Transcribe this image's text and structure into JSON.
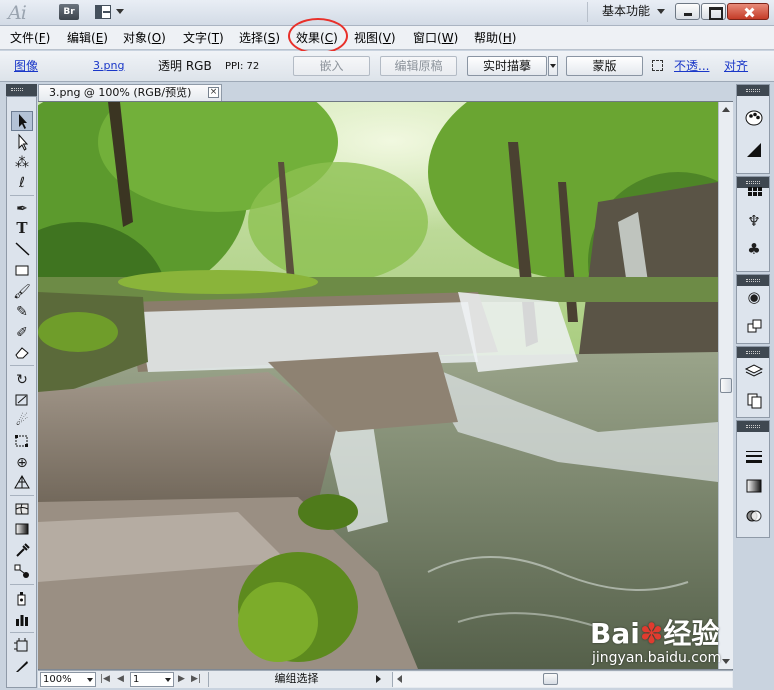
{
  "titlebar": {
    "logo": "Ai",
    "bridge_label": "Br",
    "workspace": "基本功能"
  },
  "menu": [
    {
      "label": "文件(",
      "acc": "F",
      "end": ")"
    },
    {
      "label": "编辑(",
      "acc": "E",
      "end": ")"
    },
    {
      "label": "对象(",
      "acc": "O",
      "end": ")"
    },
    {
      "label": "文字(",
      "acc": "T",
      "end": ")"
    },
    {
      "label": "选择(",
      "acc": "S",
      "end": ")"
    },
    {
      "label": "效果(",
      "acc": "C",
      "end": ")"
    },
    {
      "label": "视图(",
      "acc": "V",
      "end": ")"
    },
    {
      "label": "窗口(",
      "acc": "W",
      "end": ")"
    },
    {
      "label": "帮助(",
      "acc": "H",
      "end": ")"
    }
  ],
  "control": {
    "type_link": "图像",
    "file_link": "3.png",
    "mode": "透明 RGB",
    "ppi": "PPI: 72",
    "embed": "嵌入",
    "edit_original": "编辑原稿",
    "live_trace": "实时描摹",
    "mask": "蒙版",
    "opacity_link": "不透...",
    "align_link": "对齐"
  },
  "document": {
    "tab_title": "3.png @ 100% (RGB/预览)"
  },
  "status": {
    "zoom": "100%",
    "page": "1",
    "tool": "编组选择"
  },
  "watermark": {
    "logo_a": "Bai",
    "logo_b": "经验",
    "url": "jingyan.baidu.com"
  },
  "colors": {
    "highlight_circle": "#e8302a",
    "link": "#1a37c8"
  },
  "tools": [
    "selection-icon",
    "direct-selection-icon",
    "magic-wand-icon",
    "lasso-icon",
    "pen-icon",
    "type-icon",
    "line-icon",
    "rectangle-icon",
    "paintbrush-icon",
    "pencil-icon",
    "blob-brush-icon",
    "eraser-icon",
    "rotate-icon",
    "scale-icon",
    "warp-icon",
    "free-transform-icon",
    "shape-builder-icon",
    "graph-icon",
    "mesh-icon",
    "gradient-icon",
    "eyedropper-icon",
    "blend-icon",
    "symbol-sprayer-icon",
    "column-graph-icon",
    "artboard-icon",
    "slice-icon",
    "hand-icon"
  ],
  "right_panel_icons": [
    "color-icon",
    "color-guide-icon",
    "swatches-icon",
    "brushes-icon",
    "symbols-icon",
    "graphic-styles-icon",
    "appearance-icon",
    "layers-icon",
    "links-icon",
    "stroke-icon",
    "gradient-panel-icon",
    "transparency-icon"
  ]
}
